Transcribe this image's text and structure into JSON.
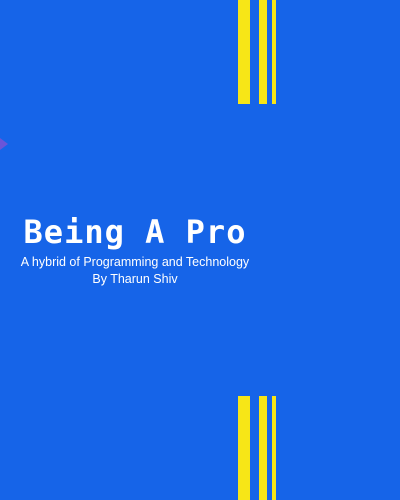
{
  "cover": {
    "title": "Being A Pro",
    "subtitle": "A hybrid of Programming and Technology",
    "author": "By Tharun Shiv"
  },
  "colors": {
    "background": "#1664e8",
    "stripes": "#f7e617",
    "text": "#ffffff"
  }
}
